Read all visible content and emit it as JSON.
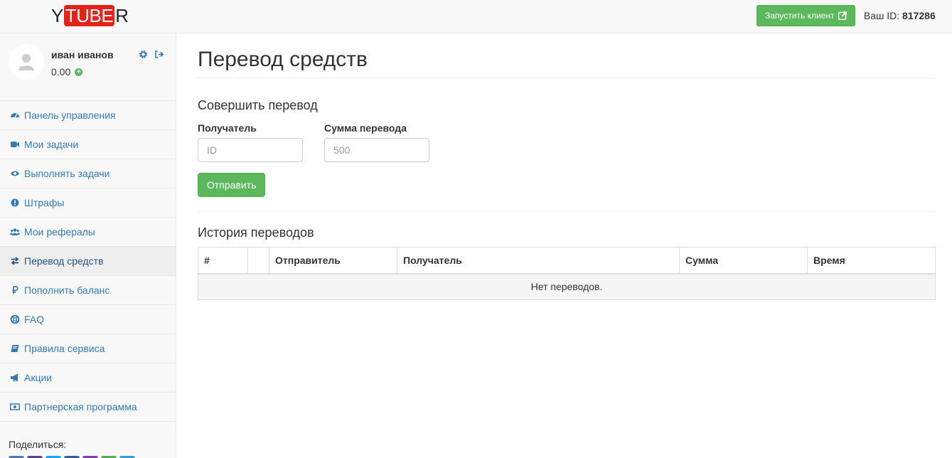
{
  "brand": {
    "logo_pre": "Y",
    "logo_box": "TUBE",
    "logo_post": "R"
  },
  "header": {
    "launch_label": "Запустить клиент",
    "id_label": "Ваш ID:",
    "id_value": "817286"
  },
  "profile": {
    "name": "иван иванов",
    "balance": "0.00"
  },
  "sidebar": {
    "items": [
      {
        "label": "Панель управления",
        "icon": "dashboard-icon"
      },
      {
        "label": "Мои задачи",
        "icon": "video-camera-icon"
      },
      {
        "label": "Выполнять задачи",
        "icon": "eye-icon"
      },
      {
        "label": "Штрафы",
        "icon": "exclamation-icon"
      },
      {
        "label": "Мои рефералы",
        "icon": "users-icon"
      },
      {
        "label": "Перевод средств",
        "icon": "exchange-icon"
      },
      {
        "label": "Пополнить баланс",
        "icon": "ruble-icon"
      },
      {
        "label": "FAQ",
        "icon": "lifebuoy-icon"
      },
      {
        "label": "Правила сервиса",
        "icon": "book-icon"
      },
      {
        "label": "Акции",
        "icon": "bullhorn-icon"
      },
      {
        "label": "Партнерская программа",
        "icon": "money-icon"
      }
    ],
    "active_index": 5,
    "share_label": "Поделиться:"
  },
  "main": {
    "title": "Перевод средств",
    "form": {
      "title": "Совершить перевод",
      "recipient_label": "Получатель",
      "recipient_placeholder": "ID",
      "recipient_value": "",
      "amount_label": "Сумма перевода",
      "amount_placeholder": "500",
      "amount_value": "",
      "submit_label": "Отправить"
    },
    "history": {
      "title": "История переводов",
      "columns": [
        "#",
        "",
        "Отправитель",
        "Получатель",
        "Сумма",
        "Время"
      ],
      "empty_text": "Нет переводов."
    }
  },
  "colors": {
    "accent": "#5cb85c",
    "link": "#337ab7",
    "logo_red": "#e62117"
  }
}
